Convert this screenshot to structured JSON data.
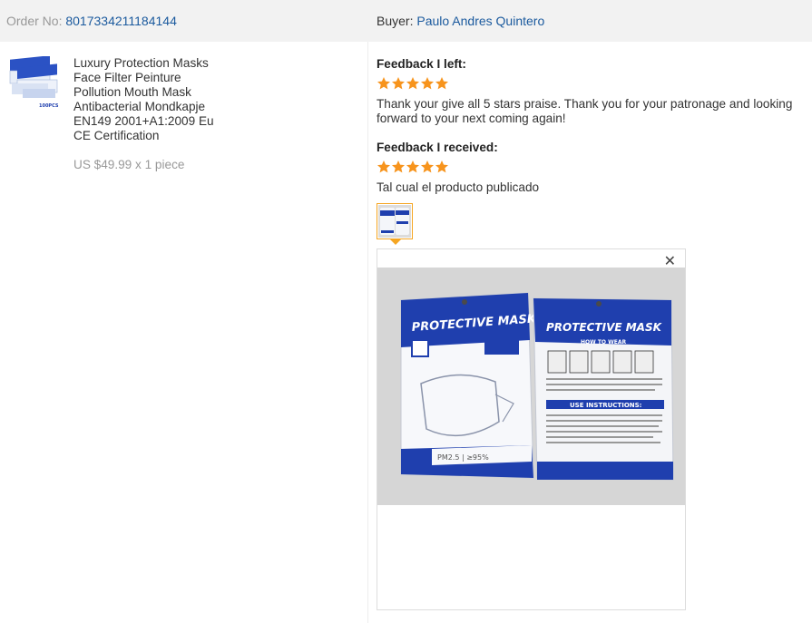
{
  "header": {
    "order_label": "Order No:",
    "order_number": "8017334211184144",
    "buyer_label": "Buyer:",
    "buyer_name": "Paulo Andres Quintero"
  },
  "product": {
    "thumb_badge": "100PCS",
    "title": "Luxury Protection Masks Face Filter Peinture Pollution Mouth Mask Antibacterial Mondkapje EN149 2001+A1:2009 Eu CE Certification",
    "price": "US $49.99 x 1 piece"
  },
  "feedback_left": {
    "title": "Feedback I left:",
    "rating": 5,
    "max_rating": 5,
    "text": "Thank your give all 5 stars praise. Thank you for your patronage and looking forward to your next coming again!"
  },
  "feedback_received": {
    "title": "Feedback I received:",
    "rating": 5,
    "max_rating": 5,
    "text": "Tal cual el producto publicado"
  },
  "viewer": {
    "close_icon": "close-icon",
    "photo_labels": {
      "left_bag": "PROTECTIVE MASK",
      "right_bag": "PROTECTIVE MASK",
      "how_to_wear": "HOW TO WEAR",
      "use_instructions": "USE INSTRUCTIONS:",
      "pm": "PM2.5 | ≥95%"
    }
  },
  "colors": {
    "link": "#1b5a9e",
    "star": "#f7941d",
    "header_bg": "#f2f2f2",
    "thumb_border": "#f5a623",
    "bag_blue": "#1f3fae"
  }
}
